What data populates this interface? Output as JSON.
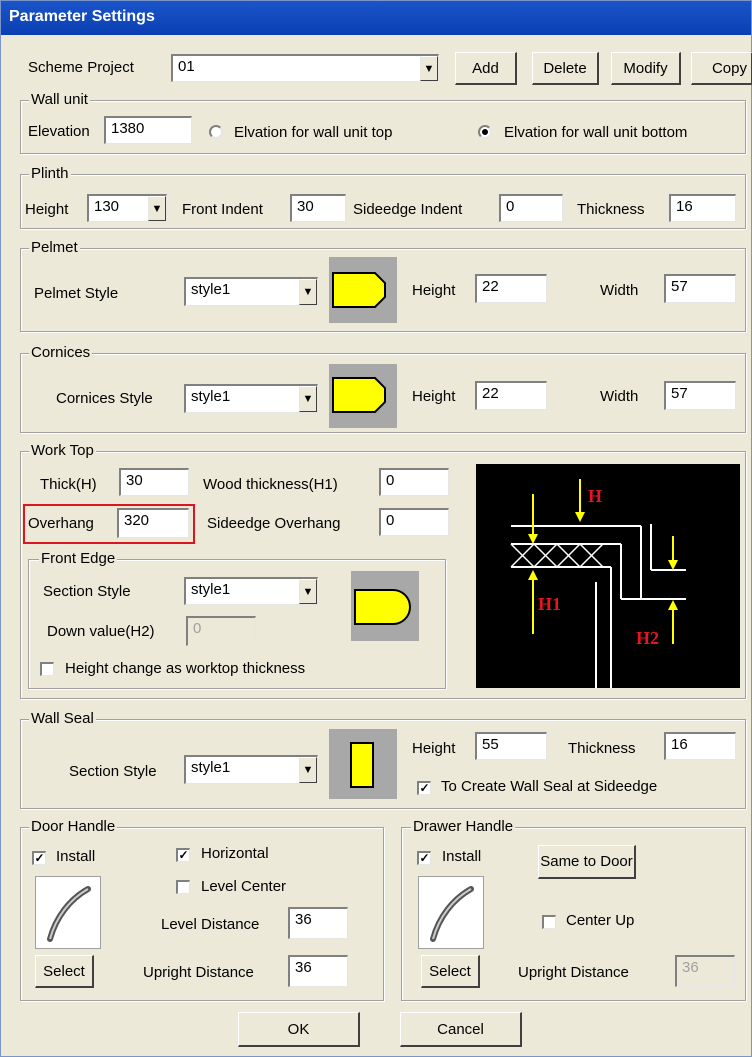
{
  "window": {
    "title": "Parameter Settings"
  },
  "scheme": {
    "label": "Scheme Project",
    "value": "01",
    "add": "Add",
    "delete": "Delete",
    "modify": "Modify",
    "copy": "Copy"
  },
  "wall_unit": {
    "title": "Wall unit",
    "elevation_label": "Elevation",
    "elevation_value": "1380",
    "opt_top": "Elvation for wall unit top",
    "opt_bottom": "Elvation for wall unit bottom",
    "selected": "bottom"
  },
  "plinth": {
    "title": "Plinth",
    "height_label": "Height",
    "height_value": "130",
    "front_indent_label": "Front Indent",
    "front_indent_value": "30",
    "sideedge_indent_label": "Sideedge Indent",
    "sideedge_indent_value": "0",
    "thickness_label": "Thickness",
    "thickness_value": "16"
  },
  "pelmet": {
    "title": "Pelmet",
    "style_label": "Pelmet Style",
    "style_value": "style1",
    "height_label": "Height",
    "height_value": "22",
    "width_label": "Width",
    "width_value": "57"
  },
  "cornices": {
    "title": "Cornices",
    "style_label": "Cornices Style",
    "style_value": "style1",
    "height_label": "Height",
    "height_value": "22",
    "width_label": "Width",
    "width_value": "57"
  },
  "work_top": {
    "title": "Work Top",
    "thick_label": "Thick(H)",
    "thick_value": "30",
    "wood_label": "Wood thickness(H1)",
    "wood_value": "0",
    "overhang_label": "Overhang",
    "overhang_value": "320",
    "side_overhang_label": "Sideedge Overhang",
    "side_overhang_value": "0",
    "diagram": {
      "h": "H",
      "h1": "H1",
      "h2": "H2"
    },
    "front_edge": {
      "title": "Front Edge",
      "section_label": "Section Style",
      "section_value": "style1",
      "down_label": "Down value(H2)",
      "down_value": "0",
      "height_change_label": "Height change as worktop thickness",
      "height_change_checked": false
    }
  },
  "wall_seal": {
    "title": "Wall Seal",
    "section_label": "Section Style",
    "section_value": "style1",
    "height_label": "Height",
    "height_value": "55",
    "thickness_label": "Thickness",
    "thickness_value": "16",
    "create_label": "To Create Wall Seal at Sideedge",
    "create_checked": true
  },
  "door_handle": {
    "title": "Door Handle",
    "install_label": "Install",
    "install_checked": true,
    "horizontal_label": "Horizontal",
    "horizontal_checked": true,
    "level_center_label": "Level Center",
    "level_center_checked": false,
    "level_distance_label": "Level Distance",
    "level_distance_value": "36",
    "upright_distance_label": "Upright Distance",
    "upright_distance_value": "36",
    "select": "Select"
  },
  "drawer_handle": {
    "title": "Drawer Handle",
    "install_label": "Install",
    "install_checked": true,
    "same_to_door": "Same to Door",
    "center_up_label": "Center Up",
    "center_up_checked": false,
    "upright_distance_label": "Upright Distance",
    "upright_distance_value": "36",
    "select": "Select"
  },
  "footer": {
    "ok": "OK",
    "cancel": "Cancel"
  },
  "colors": {
    "title_bar": "#0a3fb3",
    "dialog_bg": "#ece9d8",
    "accent_yellow": "#ffff00",
    "highlight_red": "#e0141e"
  }
}
